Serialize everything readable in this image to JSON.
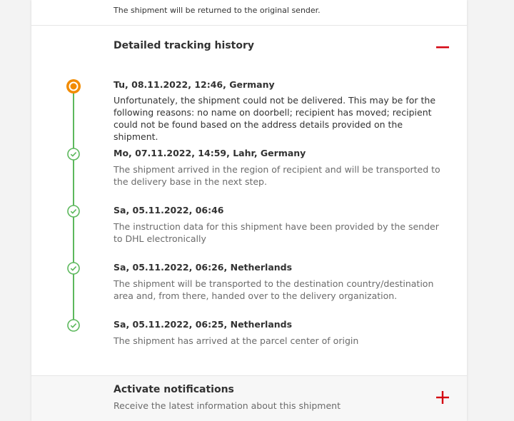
{
  "top_note": "The shipment will be returned to the original sender.",
  "history": {
    "title": "Detailed tracking history",
    "toggle_icon": "minus-icon",
    "events": [
      {
        "head": "Tu, 08.11.2022, 12:46, Germany",
        "text": "Unfortunately, the shipment could not be delivered. This may be for the following reasons: no name on doorbell; recipient has moved; recipient could not be found based on the address details provided on the shipment.",
        "status": "current"
      },
      {
        "head": "Mo, 07.11.2022, 14:59, Lahr, Germany",
        "text": "The shipment arrived in the region of recipient and will be transported to the delivery base in the next step.",
        "status": "done"
      },
      {
        "head": "Sa, 05.11.2022, 06:46",
        "text": "The instruction data for this shipment have been provided by the sender to DHL electronically",
        "status": "done"
      },
      {
        "head": "Sa, 05.11.2022, 06:26, Netherlands",
        "text": "The shipment will be transported to the destination country/destination area and, from there, handed over to the delivery organization.",
        "status": "done"
      },
      {
        "head": "Sa, 05.11.2022, 06:25, Netherlands",
        "text": "The shipment has arrived at the parcel center of origin",
        "status": "done"
      }
    ]
  },
  "notifications": {
    "title": "Activate notifications",
    "subtitle": "Receive the latest information about this shipment",
    "toggle_icon": "plus-icon"
  },
  "colors": {
    "accent_red": "#d40511",
    "current_orange": "#f28b00",
    "done_green": "#5cb85c"
  }
}
